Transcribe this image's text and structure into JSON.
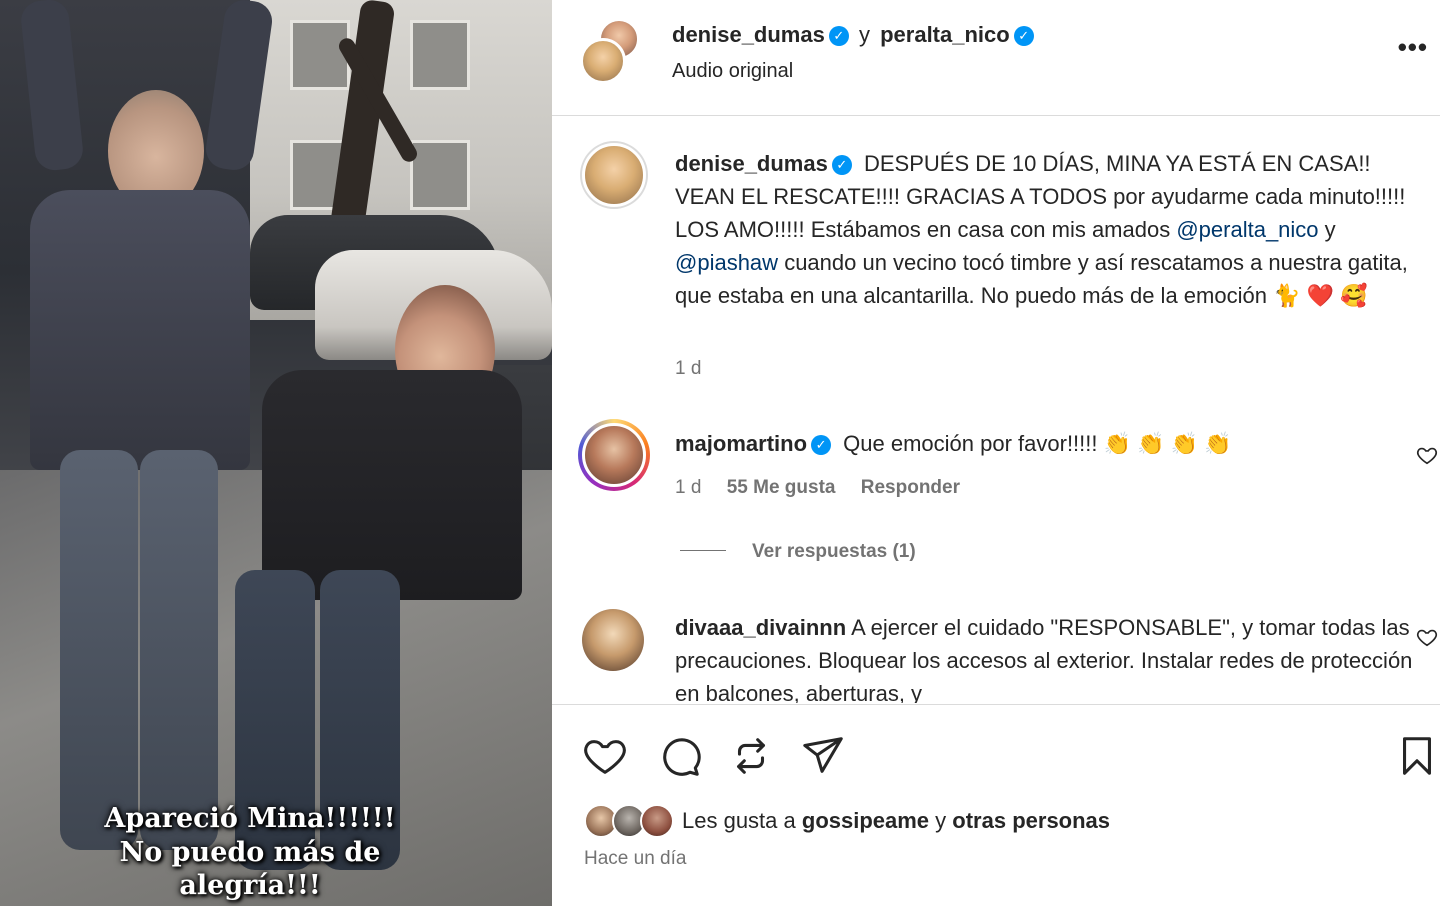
{
  "media": {
    "overlay_line1": "Apareció Mina!!!!!!",
    "overlay_line2": "No puedo más de",
    "overlay_line3": "alegría!!!"
  },
  "header": {
    "user1": "denise_dumas",
    "conjunction": "y",
    "user2": "peralta_nico",
    "subtitle": "Audio original",
    "more_label": "•••"
  },
  "caption": {
    "user": "denise_dumas",
    "text_part1": "DESPUÉS DE 10 DÍAS, MINA YA ESTÁ EN CASA!! VEAN EL RESCATE!!!! GRACIAS A TODOS por ayudarme cada minuto!!!!! LOS AMO!!!!! Estábamos en casa con mis amados",
    "mention1": "@peralta_nico",
    "text_part2": "y",
    "mention2": "@piashaw",
    "text_part3": "cuando un vecino tocó timbre y así rescatamos a nuestra gatita, que estaba en una alcantarilla. No puedo más de la emoción",
    "emojis": "🐈 ❤️ 🥰",
    "time": "1 d"
  },
  "comments": [
    {
      "user": "majomartino",
      "text": "Que emoción por favor!!!!!",
      "emojis": "👏 👏 👏 👏",
      "time": "1 d",
      "likes": "55 Me gusta",
      "reply_label": "Responder",
      "view_replies": "Ver respuestas (1)"
    },
    {
      "user": "divaaa_divainnn",
      "text": "A ejercer el cuidado \"RESPONSABLE\", y tomar todas las precauciones. Bloquear los accesos al exterior. Instalar redes de protección en balcones, aberturas, y"
    }
  ],
  "likes": {
    "prefix": "Les gusta a",
    "user": "gossipeame",
    "joiner": "y",
    "others": "otras personas"
  },
  "time_ago": "Hace un día",
  "icons": {
    "like": "heart-icon",
    "comment": "comment-icon",
    "repost": "repost-icon",
    "share": "share-icon",
    "save": "bookmark-icon",
    "verified": "verified-badge-icon"
  },
  "colors": {
    "verified": "#0095f6",
    "mention": "#00376b",
    "muted": "#737373",
    "divider": "#dbdbdb"
  }
}
